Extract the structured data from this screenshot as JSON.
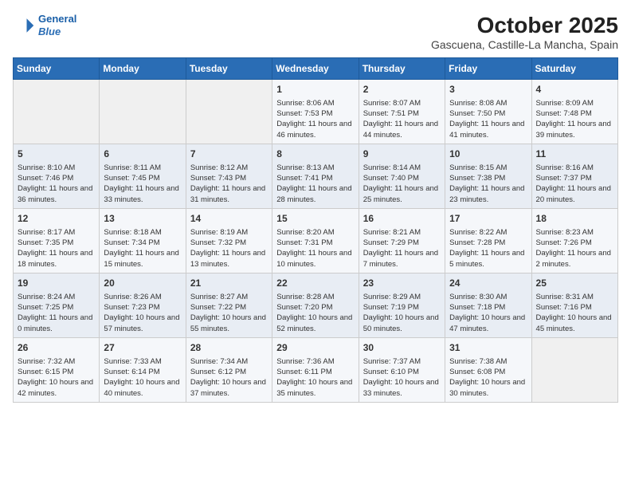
{
  "header": {
    "logo_line1": "General",
    "logo_line2": "Blue",
    "month": "October 2025",
    "location": "Gascuena, Castille-La Mancha, Spain"
  },
  "weekdays": [
    "Sunday",
    "Monday",
    "Tuesday",
    "Wednesday",
    "Thursday",
    "Friday",
    "Saturday"
  ],
  "weeks": [
    [
      {
        "day": "",
        "content": ""
      },
      {
        "day": "",
        "content": ""
      },
      {
        "day": "",
        "content": ""
      },
      {
        "day": "1",
        "content": "Sunrise: 8:06 AM\nSunset: 7:53 PM\nDaylight: 11 hours and 46 minutes."
      },
      {
        "day": "2",
        "content": "Sunrise: 8:07 AM\nSunset: 7:51 PM\nDaylight: 11 hours and 44 minutes."
      },
      {
        "day": "3",
        "content": "Sunrise: 8:08 AM\nSunset: 7:50 PM\nDaylight: 11 hours and 41 minutes."
      },
      {
        "day": "4",
        "content": "Sunrise: 8:09 AM\nSunset: 7:48 PM\nDaylight: 11 hours and 39 minutes."
      }
    ],
    [
      {
        "day": "5",
        "content": "Sunrise: 8:10 AM\nSunset: 7:46 PM\nDaylight: 11 hours and 36 minutes."
      },
      {
        "day": "6",
        "content": "Sunrise: 8:11 AM\nSunset: 7:45 PM\nDaylight: 11 hours and 33 minutes."
      },
      {
        "day": "7",
        "content": "Sunrise: 8:12 AM\nSunset: 7:43 PM\nDaylight: 11 hours and 31 minutes."
      },
      {
        "day": "8",
        "content": "Sunrise: 8:13 AM\nSunset: 7:41 PM\nDaylight: 11 hours and 28 minutes."
      },
      {
        "day": "9",
        "content": "Sunrise: 8:14 AM\nSunset: 7:40 PM\nDaylight: 11 hours and 25 minutes."
      },
      {
        "day": "10",
        "content": "Sunrise: 8:15 AM\nSunset: 7:38 PM\nDaylight: 11 hours and 23 minutes."
      },
      {
        "day": "11",
        "content": "Sunrise: 8:16 AM\nSunset: 7:37 PM\nDaylight: 11 hours and 20 minutes."
      }
    ],
    [
      {
        "day": "12",
        "content": "Sunrise: 8:17 AM\nSunset: 7:35 PM\nDaylight: 11 hours and 18 minutes."
      },
      {
        "day": "13",
        "content": "Sunrise: 8:18 AM\nSunset: 7:34 PM\nDaylight: 11 hours and 15 minutes."
      },
      {
        "day": "14",
        "content": "Sunrise: 8:19 AM\nSunset: 7:32 PM\nDaylight: 11 hours and 13 minutes."
      },
      {
        "day": "15",
        "content": "Sunrise: 8:20 AM\nSunset: 7:31 PM\nDaylight: 11 hours and 10 minutes."
      },
      {
        "day": "16",
        "content": "Sunrise: 8:21 AM\nSunset: 7:29 PM\nDaylight: 11 hours and 7 minutes."
      },
      {
        "day": "17",
        "content": "Sunrise: 8:22 AM\nSunset: 7:28 PM\nDaylight: 11 hours and 5 minutes."
      },
      {
        "day": "18",
        "content": "Sunrise: 8:23 AM\nSunset: 7:26 PM\nDaylight: 11 hours and 2 minutes."
      }
    ],
    [
      {
        "day": "19",
        "content": "Sunrise: 8:24 AM\nSunset: 7:25 PM\nDaylight: 11 hours and 0 minutes."
      },
      {
        "day": "20",
        "content": "Sunrise: 8:26 AM\nSunset: 7:23 PM\nDaylight: 10 hours and 57 minutes."
      },
      {
        "day": "21",
        "content": "Sunrise: 8:27 AM\nSunset: 7:22 PM\nDaylight: 10 hours and 55 minutes."
      },
      {
        "day": "22",
        "content": "Sunrise: 8:28 AM\nSunset: 7:20 PM\nDaylight: 10 hours and 52 minutes."
      },
      {
        "day": "23",
        "content": "Sunrise: 8:29 AM\nSunset: 7:19 PM\nDaylight: 10 hours and 50 minutes."
      },
      {
        "day": "24",
        "content": "Sunrise: 8:30 AM\nSunset: 7:18 PM\nDaylight: 10 hours and 47 minutes."
      },
      {
        "day": "25",
        "content": "Sunrise: 8:31 AM\nSunset: 7:16 PM\nDaylight: 10 hours and 45 minutes."
      }
    ],
    [
      {
        "day": "26",
        "content": "Sunrise: 7:32 AM\nSunset: 6:15 PM\nDaylight: 10 hours and 42 minutes."
      },
      {
        "day": "27",
        "content": "Sunrise: 7:33 AM\nSunset: 6:14 PM\nDaylight: 10 hours and 40 minutes."
      },
      {
        "day": "28",
        "content": "Sunrise: 7:34 AM\nSunset: 6:12 PM\nDaylight: 10 hours and 37 minutes."
      },
      {
        "day": "29",
        "content": "Sunrise: 7:36 AM\nSunset: 6:11 PM\nDaylight: 10 hours and 35 minutes."
      },
      {
        "day": "30",
        "content": "Sunrise: 7:37 AM\nSunset: 6:10 PM\nDaylight: 10 hours and 33 minutes."
      },
      {
        "day": "31",
        "content": "Sunrise: 7:38 AM\nSunset: 6:08 PM\nDaylight: 10 hours and 30 minutes."
      },
      {
        "day": "",
        "content": ""
      }
    ]
  ]
}
